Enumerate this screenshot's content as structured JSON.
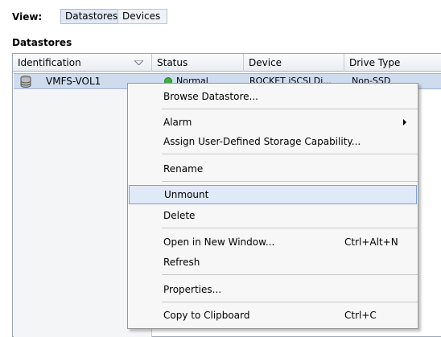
{
  "viewbar": {
    "label": "View:",
    "buttons": [
      "Datastores",
      "Devices"
    ]
  },
  "section_title": "Datastores",
  "grid": {
    "columns": [
      "Identification",
      "Status",
      "Device",
      "Drive Type"
    ],
    "rows": [
      {
        "name": "VMFS-VOL1",
        "status": "Normal",
        "device": "ROCKET iSCSI Di...",
        "drive_type": "Non-SSD"
      }
    ]
  },
  "context_menu": {
    "items": [
      {
        "label": "Browse Datastore..."
      },
      {
        "label": "Alarm",
        "submenu": true
      },
      {
        "label": "Assign User-Defined Storage Capability..."
      },
      {
        "label": "Rename"
      },
      {
        "label": "Unmount",
        "highlighted": true
      },
      {
        "label": "Delete"
      },
      {
        "label": "Open in New Window...",
        "shortcut": "Ctrl+Alt+N"
      },
      {
        "label": "Refresh"
      },
      {
        "label": "Properties..."
      },
      {
        "label": "Copy to Clipboard",
        "shortcut": "Ctrl+C"
      }
    ]
  },
  "colors": {
    "selection": "#cfdcee",
    "menu_highlight": "#dfe9f7",
    "status_ok": "#3fae3f"
  }
}
